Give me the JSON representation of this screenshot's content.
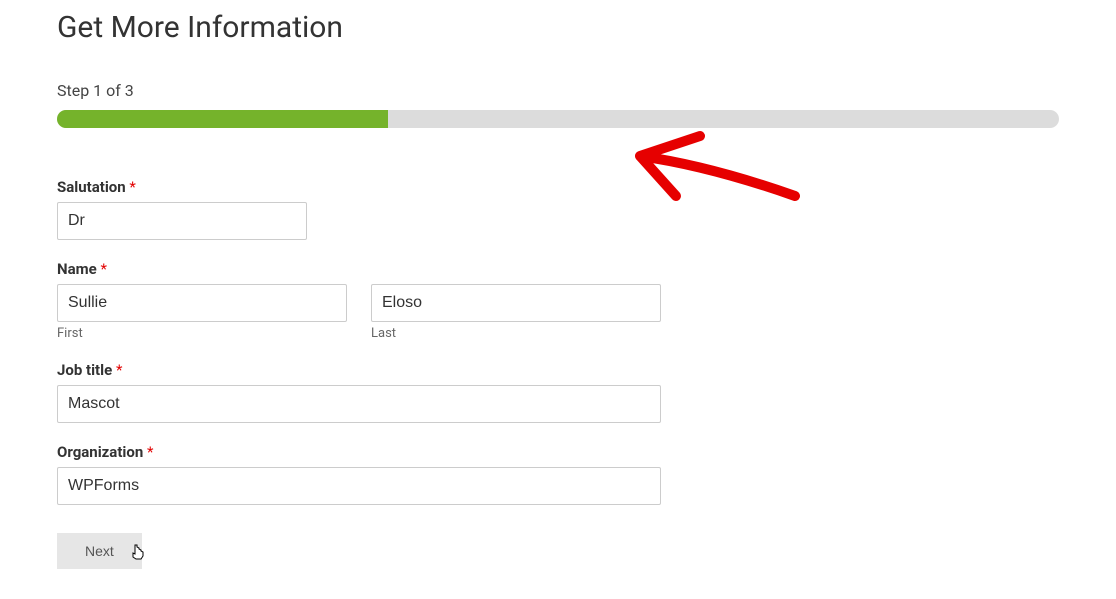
{
  "form": {
    "title": "Get More Information",
    "step_indicator": "Step 1 of 3",
    "progress_percent": 33,
    "fields": {
      "salutation": {
        "label": "Salutation",
        "value": "Dr"
      },
      "name": {
        "label": "Name",
        "first": {
          "value": "Sullie",
          "sublabel": "First"
        },
        "last": {
          "value": "Eloso",
          "sublabel": "Last"
        }
      },
      "job_title": {
        "label": "Job title",
        "value": "Mascot"
      },
      "organization": {
        "label": "Organization",
        "value": "WPForms"
      }
    },
    "next_button": "Next",
    "required_marker": "*"
  },
  "colors": {
    "progress_fill": "#75b32b",
    "required": "#e20000"
  }
}
